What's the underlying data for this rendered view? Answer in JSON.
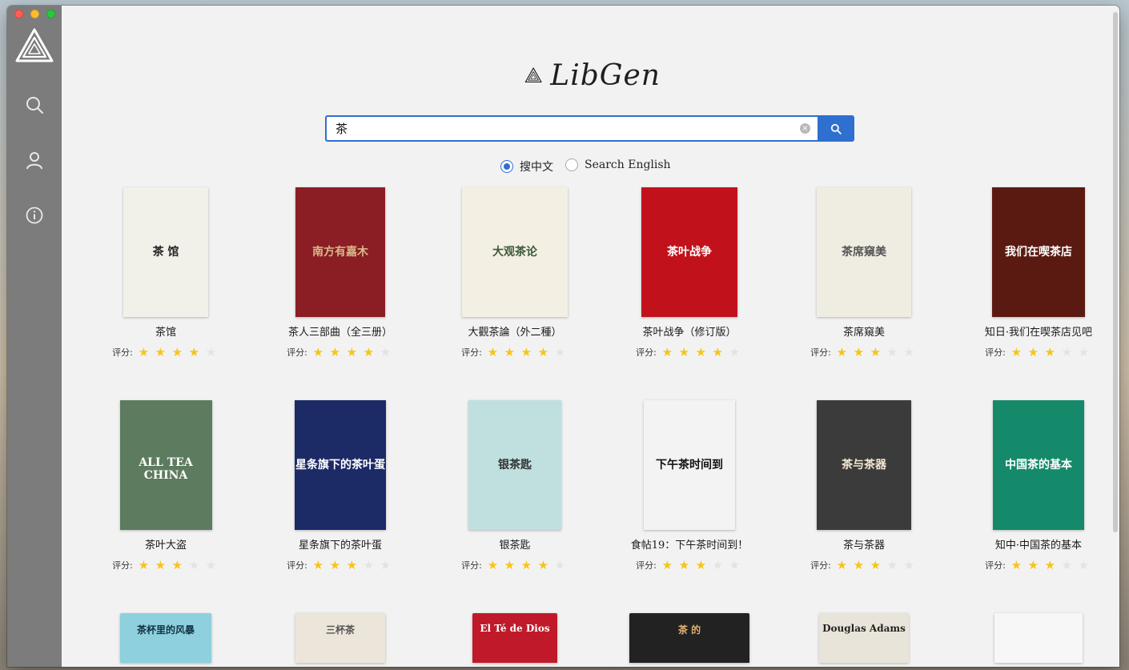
{
  "app": {
    "name": "LibGen"
  },
  "sidebar": {
    "items": [
      {
        "name": "search",
        "icon": "search-icon"
      },
      {
        "name": "account",
        "icon": "user-icon"
      },
      {
        "name": "about",
        "icon": "info-icon"
      }
    ]
  },
  "search": {
    "value": "茶",
    "placeholder": ""
  },
  "language": {
    "options": [
      {
        "label": "搜中文",
        "selected": true
      },
      {
        "label": "Search English",
        "selected": false
      }
    ]
  },
  "rating_label": "评分:",
  "books": [
    {
      "title": "茶馆",
      "rating": 4,
      "cover": {
        "bg": "#f1f0e9",
        "fg": "#222222",
        "text": "茶 馆"
      }
    },
    {
      "title": "茶人三部曲（全三册）",
      "rating": 4,
      "cover": {
        "bg": "#8b1d24",
        "fg": "#d9b98c",
        "text": "南方有嘉木"
      }
    },
    {
      "title": "大觀茶論（外二種）",
      "rating": 4,
      "cover": {
        "bg": "#f4efe3",
        "fg": "#3c5a3a",
        "text": "大观茶论"
      }
    },
    {
      "title": "茶叶战争（修订版）",
      "rating": 4,
      "cover": {
        "bg": "#c1121c",
        "fg": "#ffffff",
        "text": "茶叶战争"
      }
    },
    {
      "title": "茶席窺美",
      "rating": 3,
      "cover": {
        "bg": "#efece2",
        "fg": "#555555",
        "text": "茶席窺美"
      }
    },
    {
      "title": "知日·我们在喫茶店见吧",
      "rating": 3,
      "cover": {
        "bg": "#5a1a12",
        "fg": "#ffffff",
        "text": "我们在喫茶店"
      }
    },
    {
      "title": "茶叶大盗",
      "rating": 3,
      "cover": {
        "bg": "#5d7b5e",
        "fg": "#ffffff",
        "text": "ALL TEA CHINA"
      }
    },
    {
      "title": "星条旗下的茶叶蛋",
      "rating": 3,
      "cover": {
        "bg": "#1c2a66",
        "fg": "#ffffff",
        "text": "星条旗下的茶叶蛋"
      }
    },
    {
      "title": "银茶匙",
      "rating": 4,
      "cover": {
        "bg": "#bfe0de",
        "fg": "#333333",
        "text": "银茶匙"
      }
    },
    {
      "title": "食帖19：下午茶时间到！",
      "rating": 3,
      "cover": {
        "bg": "#f3f3f3",
        "fg": "#111111",
        "text": "下午茶时间到"
      }
    },
    {
      "title": "茶与茶器",
      "rating": 3,
      "cover": {
        "bg": "#3b3b3b",
        "fg": "#f2e7cf",
        "text": "茶与茶器"
      }
    },
    {
      "title": "知中·中国茶的基本",
      "rating": 3,
      "cover": {
        "bg": "#148a6a",
        "fg": "#ffffff",
        "text": "中国茶的基本"
      }
    },
    {
      "title": "",
      "rating": 0,
      "cover": {
        "bg": "#8ed0dd",
        "fg": "#113344",
        "text": "茶杯里的风暴"
      }
    },
    {
      "title": "",
      "rating": 0,
      "cover": {
        "bg": "#ece6da",
        "fg": "#555555",
        "text": "三杯茶"
      }
    },
    {
      "title": "",
      "rating": 0,
      "cover": {
        "bg": "#c01a2a",
        "fg": "#ffffff",
        "text": "El Té de Dios"
      }
    },
    {
      "title": "",
      "rating": 0,
      "cover": {
        "bg": "#222222",
        "fg": "#e0b070",
        "text": "茶 的"
      }
    },
    {
      "title": "",
      "rating": 0,
      "cover": {
        "bg": "#e9e4d9",
        "fg": "#222222",
        "text": "Douglas Adams"
      }
    },
    {
      "title": "",
      "rating": 0,
      "cover": {
        "bg": "#f7f7f7",
        "fg": "#aaaaaa",
        "text": ""
      }
    }
  ]
}
